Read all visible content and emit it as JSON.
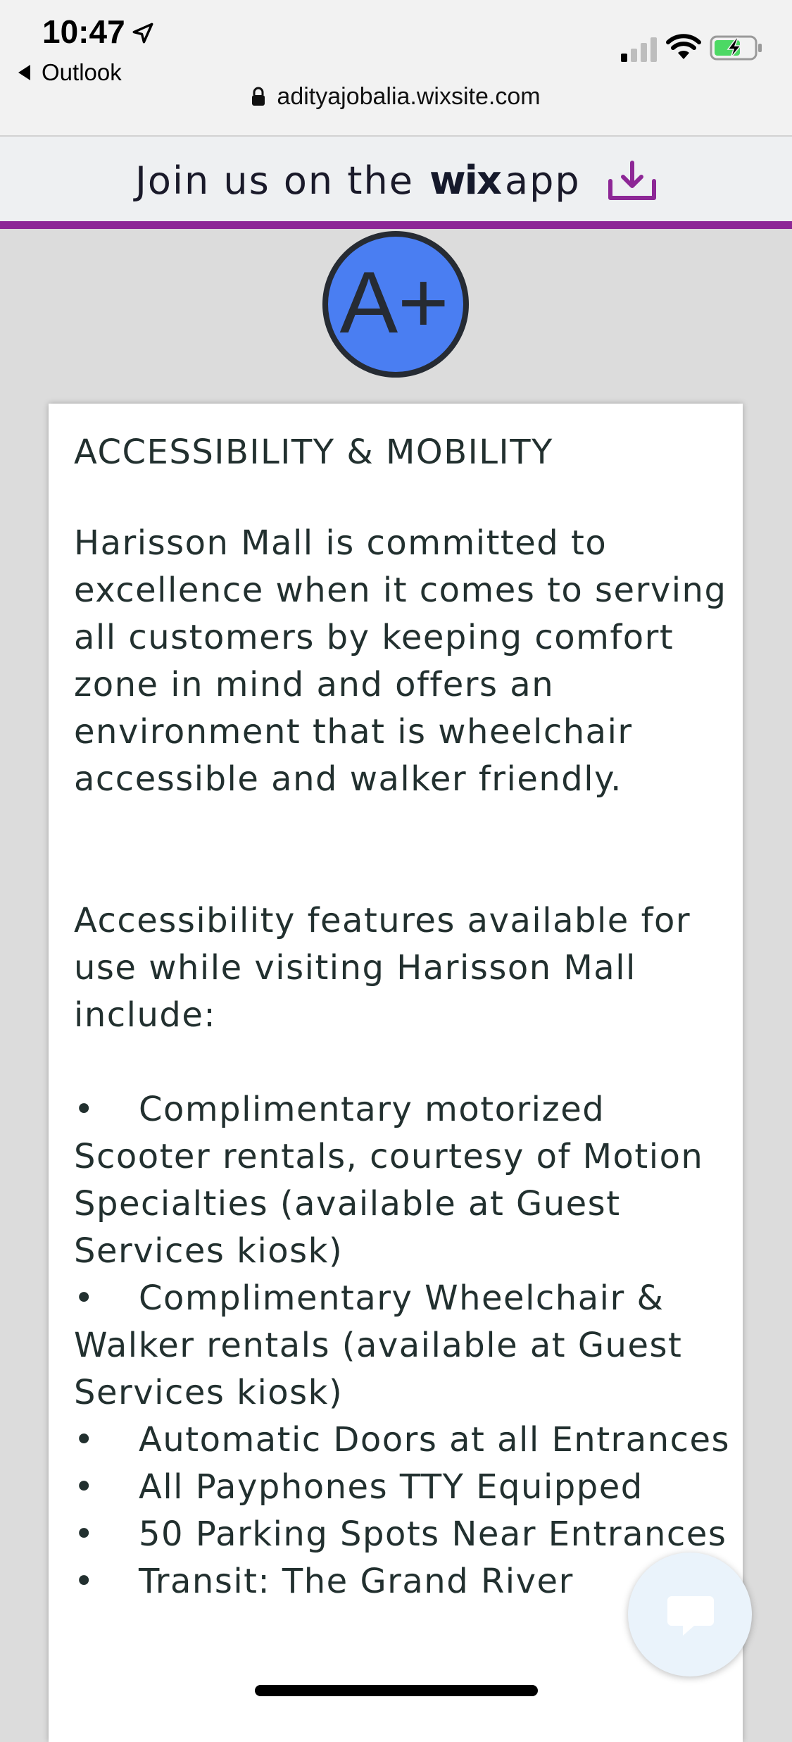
{
  "status_bar": {
    "time": "10:47",
    "back_label": "Outlook"
  },
  "url_bar": {
    "url": "adityajobalia.wixsite.com"
  },
  "banner": {
    "prefix": "Join us on the",
    "logo_text": "wix",
    "suffix": "app",
    "accent_color": "#8d2796"
  },
  "logo": {
    "text": "A+",
    "color": "#4a7ef2"
  },
  "content": {
    "heading": "ACCESSIBILITY & MOBILITY",
    "intro": "Harisson Mall is committed to excellence when it comes to serving all customers by keeping comfort zone in mind and offers an environment that is wheelchair accessible and walker friendly.",
    "features_intro": "Accessibility features available for use while visiting Harisson Mall include:",
    "bullet": "•",
    "features": [
      "Complimentary motorized Scooter rentals, courtesy of Motion Specialties (available at Guest Services kiosk)",
      "Complimentary Wheelchair & Walker rentals (available at Guest Services kiosk)",
      "Automatic Doors at all Entrances",
      "All Payphones TTY Equipped",
      "50 Parking Spots Near Entrances",
      "Transit: The Grand River"
    ]
  },
  "chat": {
    "icon": "chat-bubble-icon"
  }
}
